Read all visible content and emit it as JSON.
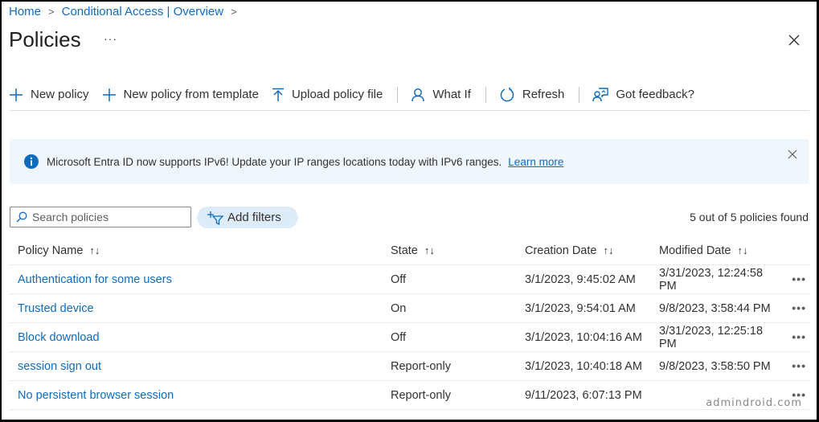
{
  "breadcrumb": [
    {
      "label": "Home"
    },
    {
      "label": "Conditional Access | Overview"
    }
  ],
  "page": {
    "title": "Policies",
    "more_label": "···"
  },
  "toolbar": {
    "new_policy": "New policy",
    "new_from_template": "New policy from template",
    "upload": "Upload policy file",
    "what_if": "What If",
    "refresh": "Refresh",
    "feedback": "Got feedback?"
  },
  "banner": {
    "message": "Microsoft Entra ID now supports IPv6! Update your IP ranges locations today with IPv6 ranges.",
    "link": "Learn more"
  },
  "search": {
    "placeholder": "Search policies",
    "value": ""
  },
  "filters": {
    "label": "Add filters"
  },
  "result_count": "5 out of 5 policies found",
  "table": {
    "columns": [
      "Policy Name",
      "State",
      "Creation Date",
      "Modified Date"
    ],
    "sort_glyph": "↑↓",
    "rows": [
      {
        "name": "Authentication for some users",
        "state": "Off",
        "created": "3/1/2023, 9:45:02 AM",
        "modified": "3/31/2023, 12:24:58 PM"
      },
      {
        "name": "Trusted device",
        "state": "On",
        "created": "3/1/2023, 9:54:01 AM",
        "modified": "9/8/2023, 3:58:44 PM"
      },
      {
        "name": "Block download",
        "state": "Off",
        "created": "3/1/2023, 10:04:16 AM",
        "modified": "3/31/2023, 12:25:18 PM"
      },
      {
        "name": "session sign out",
        "state": "Report-only",
        "created": "3/1/2023, 10:40:18 AM",
        "modified": "9/8/2023, 3:58:50 PM"
      },
      {
        "name": "No persistent browser session",
        "state": "Report-only",
        "created": "9/11/2023, 6:07:13 PM",
        "modified": ""
      }
    ],
    "row_more_label": "•••"
  },
  "watermark": "admindroid.com",
  "colors": {
    "accent": "#0f6cbd",
    "banner_bg": "#eff6fc",
    "filter_bg": "#deecf9"
  }
}
